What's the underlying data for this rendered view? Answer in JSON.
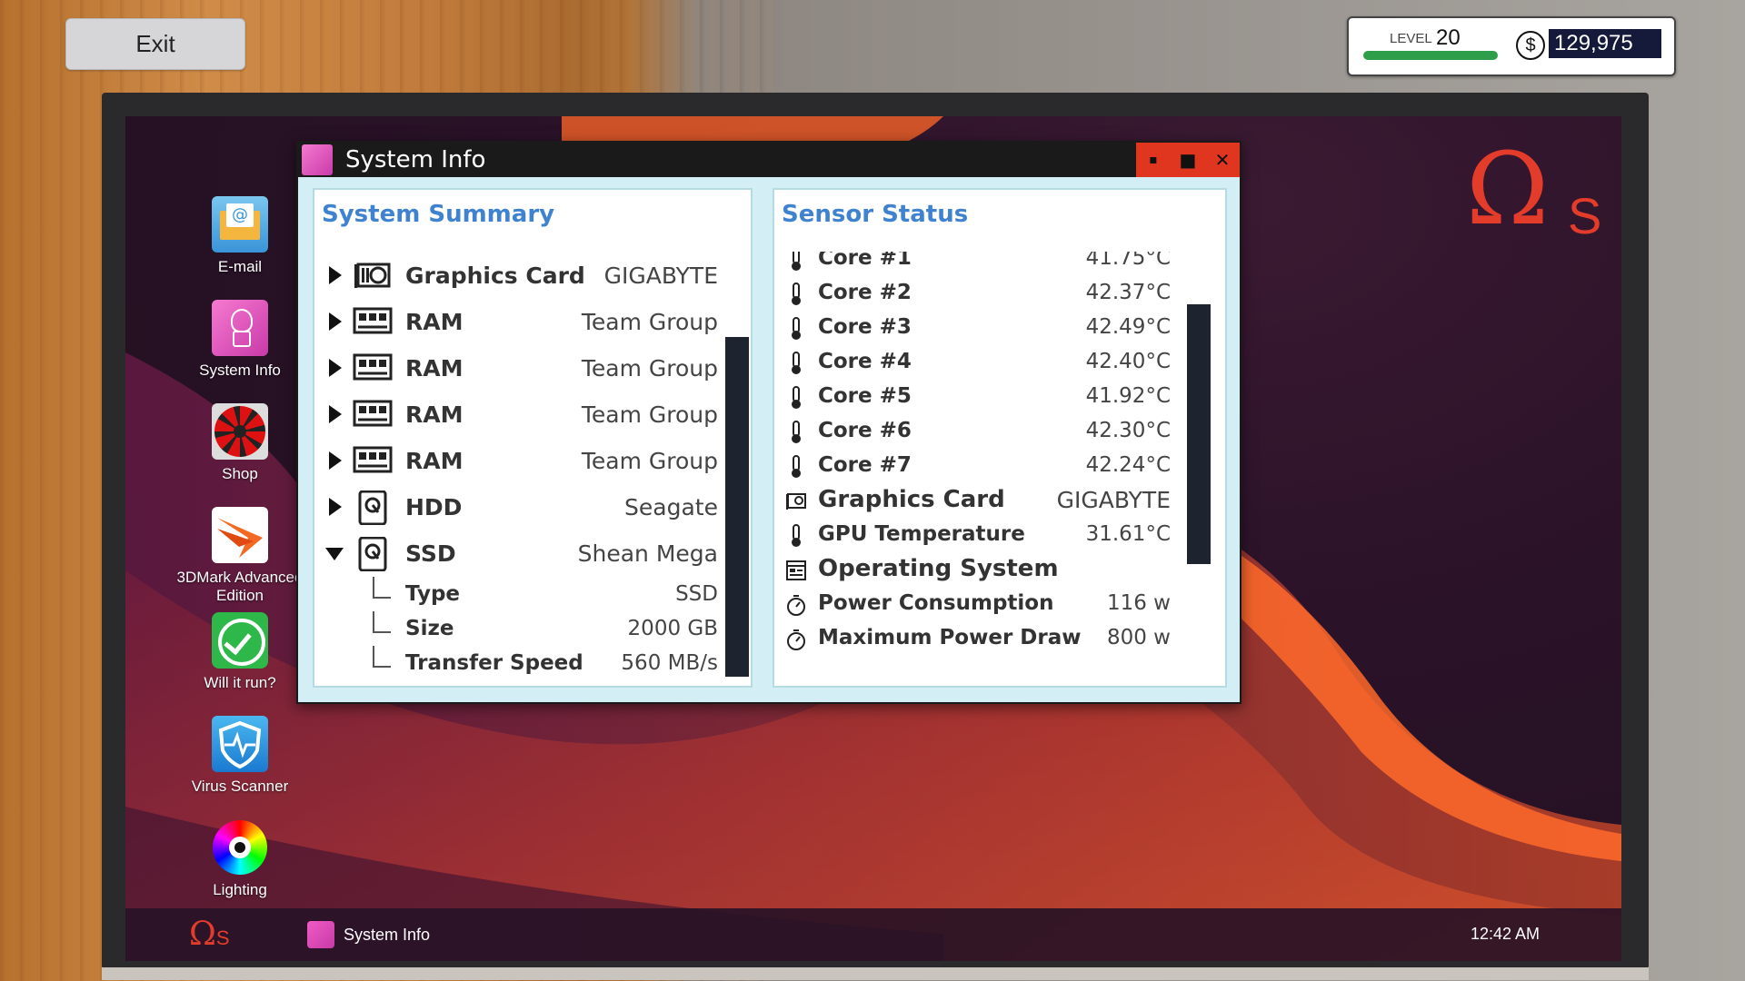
{
  "exit_label": "Exit",
  "hud": {
    "level_label": "LEVEL",
    "level_value": "20",
    "xp_progress": 1.0,
    "money_symbol": "$",
    "money_value": "129,975"
  },
  "desktop": {
    "icons": [
      {
        "label": "E-mail"
      },
      {
        "label": "System Info"
      },
      {
        "label": "Shop"
      },
      {
        "label": "3DMark Advanced Edition"
      },
      {
        "label": "Will it run?"
      },
      {
        "label": "Virus Scanner"
      },
      {
        "label": "Lighting"
      }
    ],
    "brand": {
      "omega": "Ω",
      "s": "S"
    }
  },
  "taskbar": {
    "start_omega": "Ω",
    "start_s": "S",
    "task_label": "System Info",
    "clock": "12:42 AM"
  },
  "window": {
    "title": "System Info",
    "buttons": {
      "minimize": "▪",
      "maximize": "■",
      "close": "✕"
    },
    "summary": {
      "heading": "System Summary",
      "items": [
        {
          "name": "Graphics Card",
          "value": "GIGABYTE",
          "icon": "gpu-icon"
        },
        {
          "name": "RAM",
          "value": "Team Group",
          "icon": "ram-icon"
        },
        {
          "name": "RAM",
          "value": "Team Group",
          "icon": "ram-icon"
        },
        {
          "name": "RAM",
          "value": "Team Group",
          "icon": "ram-icon"
        },
        {
          "name": "RAM",
          "value": "Team Group",
          "icon": "ram-icon"
        },
        {
          "name": "HDD",
          "value": "Seagate",
          "icon": "drive-icon"
        },
        {
          "name": "SSD",
          "value": "Shean Mega",
          "icon": "drive-icon"
        }
      ],
      "ssd_details": [
        {
          "name": "Type",
          "value": "SSD"
        },
        {
          "name": "Size",
          "value": "2000 GB"
        },
        {
          "name": "Transfer Speed",
          "value": "560 MB/s"
        }
      ]
    },
    "sensors": {
      "heading": "Sensor Status",
      "items": [
        {
          "name": "Core #1",
          "value": "41.75°C",
          "icon": "thermometer-icon"
        },
        {
          "name": "Core #2",
          "value": "42.37°C",
          "icon": "thermometer-icon"
        },
        {
          "name": "Core #3",
          "value": "42.49°C",
          "icon": "thermometer-icon"
        },
        {
          "name": "Core #4",
          "value": "42.40°C",
          "icon": "thermometer-icon"
        },
        {
          "name": "Core #5",
          "value": "41.92°C",
          "icon": "thermometer-icon"
        },
        {
          "name": "Core #6",
          "value": "42.30°C",
          "icon": "thermometer-icon"
        },
        {
          "name": "Core #7",
          "value": "42.24°C",
          "icon": "thermometer-icon"
        },
        {
          "name": "Graphics Card",
          "value": "GIGABYTE",
          "icon": "gpu-icon"
        },
        {
          "name": "GPU Temperature",
          "value": "31.61°C",
          "icon": "thermometer-icon"
        },
        {
          "name": "Operating System",
          "value": "",
          "icon": "os-icon"
        },
        {
          "name": "Power Consumption",
          "value": "116 w",
          "icon": "stopwatch-icon"
        },
        {
          "name": "Maximum Power Draw",
          "value": "800 w",
          "icon": "stopwatch-icon"
        }
      ]
    }
  },
  "colors": {
    "accent_red": "#e0361f",
    "heading_blue": "#3f83d0",
    "money_bg": "#151a3a",
    "xp_green": "#2f9e4a"
  }
}
